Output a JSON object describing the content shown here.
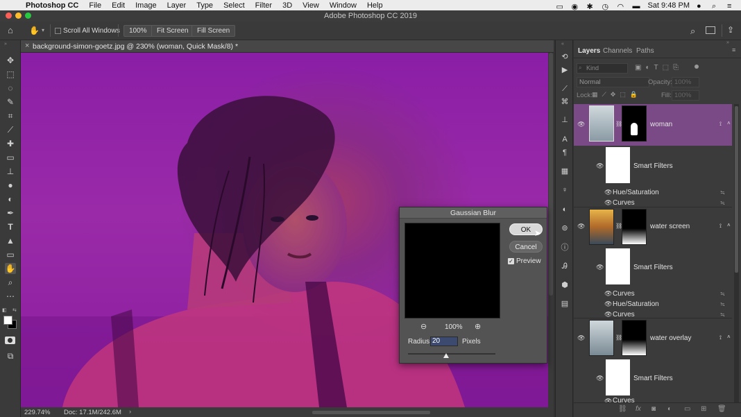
{
  "menubar": {
    "app_name": "Photoshop CC",
    "items": [
      "File",
      "Edit",
      "Image",
      "Layer",
      "Type",
      "Select",
      "Filter",
      "3D",
      "View",
      "Window",
      "Help"
    ],
    "clock": "Sat 9:48 PM"
  },
  "window": {
    "title": "Adobe Photoshop CC 2019"
  },
  "options_bar": {
    "scroll_all_windows": "Scroll All Windows",
    "zoom_100": "100%",
    "fit_screen": "Fit Screen",
    "fill_screen": "Fill Screen"
  },
  "document": {
    "tab_title": "background-simon-goetz.jpg @ 230% (woman, Quick Mask/8) *"
  },
  "status": {
    "zoom": "229.74%",
    "doc_size": "Doc: 17.1M/242.6M"
  },
  "dialog": {
    "title": "Gaussian Blur",
    "ok": "OK",
    "cancel": "Cancel",
    "preview_label": "Preview",
    "preview_checked": true,
    "zoom": "100%",
    "radius_label": "Radius:",
    "radius_value": "20",
    "units": "Pixels"
  },
  "layers_panel": {
    "tabs": [
      "Layers",
      "Channels",
      "Paths"
    ],
    "kind_label": "Kind",
    "blend_mode": "Normal",
    "opacity_label": "Opacity:",
    "opacity_value": "100%",
    "lock_label": "Lock:",
    "fill_label": "Fill:",
    "fill_value": "100%",
    "layers": [
      {
        "name": "woman",
        "smart_filters": "Smart Filters",
        "filters": [
          "Hue/Saturation",
          "Curves"
        ]
      },
      {
        "name": "water screen",
        "smart_filters": "Smart Filters",
        "filters": [
          "Curves",
          "Hue/Saturation",
          "Curves"
        ]
      },
      {
        "name": "water overlay",
        "smart_filters": "Smart Filters",
        "filters": [
          "Curves"
        ]
      }
    ]
  },
  "colors": {
    "quick_mask": "#9a22aa",
    "selected_layer": "#7a4a86",
    "panel_bg": "#3b3b3b"
  }
}
